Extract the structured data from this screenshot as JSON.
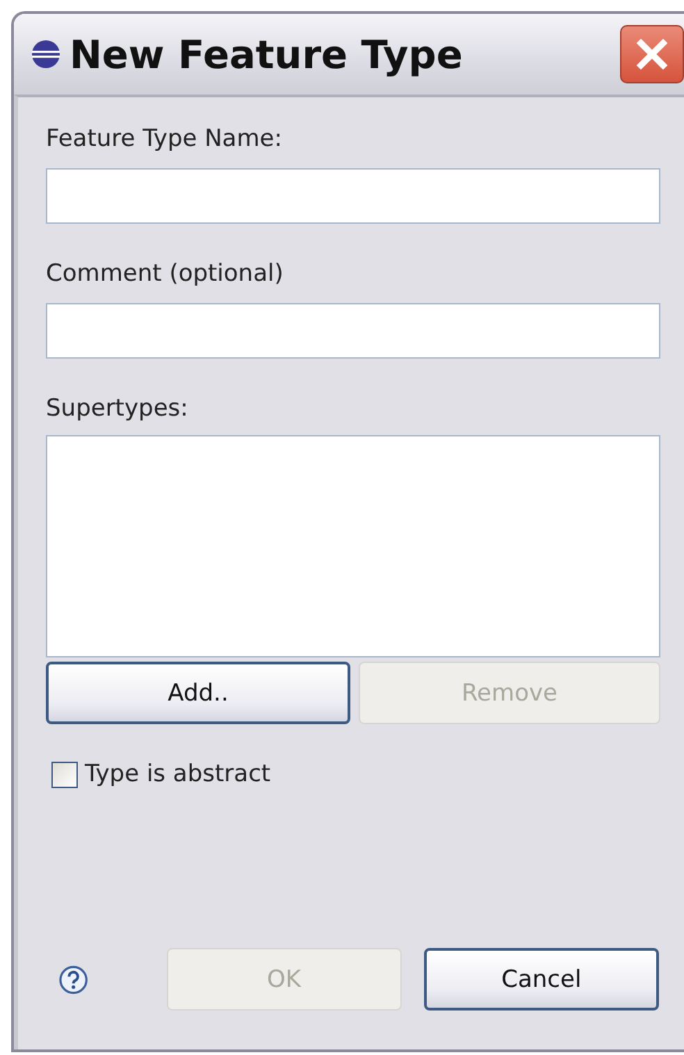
{
  "window": {
    "title": "New Feature Type"
  },
  "fields": [
    {
      "label": "Feature Type Name:"
    },
    {
      "label": "Comment (optional)"
    }
  ],
  "supertypes": {
    "label": "Supertypes:"
  },
  "list_buttons": [
    {
      "label": "Add..",
      "disabled": false
    },
    {
      "label": "Remove",
      "disabled": true
    }
  ],
  "checkbox": {
    "label": "Type is abstract",
    "checked": false
  },
  "dialog_buttons": [
    {
      "label": "OK",
      "disabled": true
    },
    {
      "label": "Cancel",
      "disabled": false
    }
  ]
}
